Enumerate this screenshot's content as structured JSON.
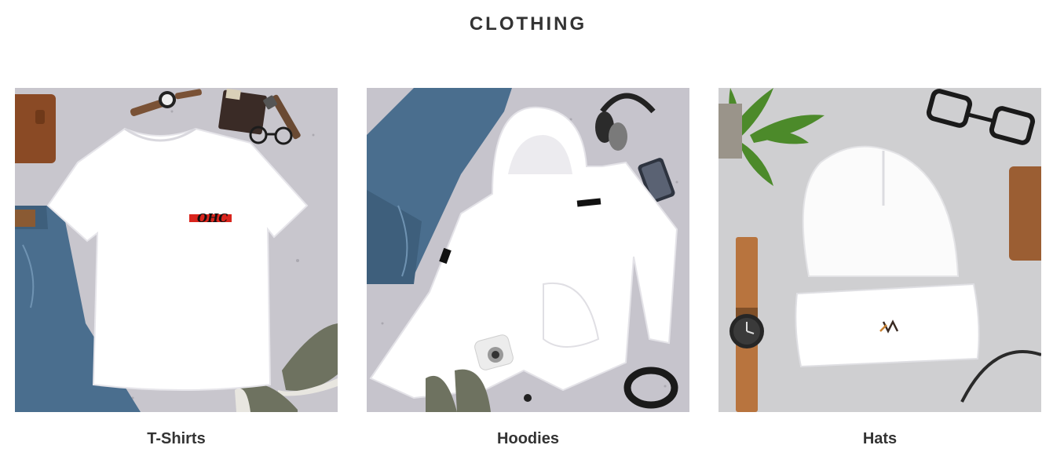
{
  "section": {
    "title": "CLOTHING"
  },
  "collections": [
    {
      "label": "T-Shirts",
      "image_icon": "white-tshirt-flatlay",
      "print_text": "OHC"
    },
    {
      "label": "Hoodies",
      "image_icon": "white-hoodie-flatlay"
    },
    {
      "label": "Hats",
      "image_icon": "white-beanie-flatlay"
    }
  ],
  "colors": {
    "text": "#333333",
    "background": "#ffffff",
    "concrete": "#c9c7cc",
    "denim": "#4a6e8e"
  }
}
